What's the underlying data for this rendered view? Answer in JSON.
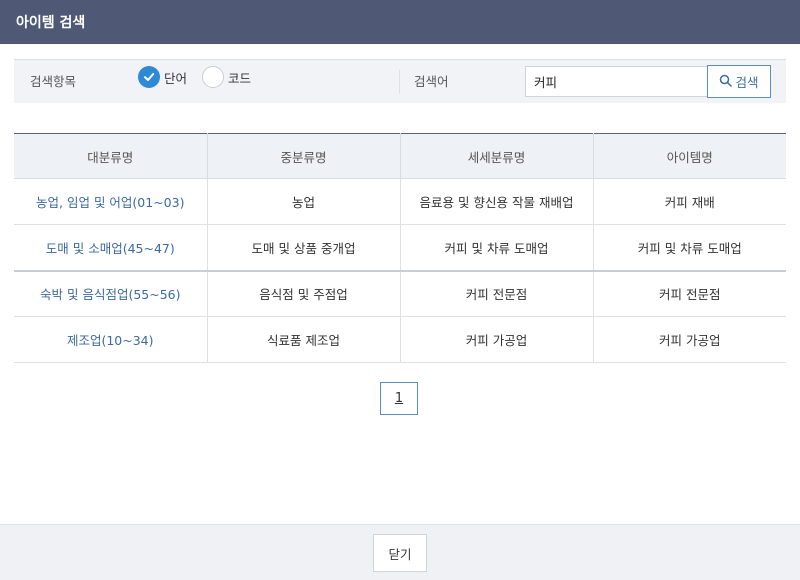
{
  "dialog": {
    "title": "아이템 검색"
  },
  "search": {
    "field_label": "검색항목",
    "radio_word": "단어",
    "radio_code": "코드",
    "selected": "단어",
    "word_label": "검색어",
    "input_value": "커피",
    "button_label": "검색",
    "button_icon": "search-icon"
  },
  "table": {
    "headers": [
      "대분류명",
      "중분류명",
      "세세분류명",
      "아이템명"
    ],
    "rows": [
      [
        "농업, 임업 및 어업(01~03)",
        "농업",
        "음료용 및 향신용 작물 재배업",
        "커피 재배"
      ],
      [
        "도매 및 소매업(45~47)",
        "도매 및 상품 중개업",
        "커피 및 차류 도매업",
        "커피 및 차류 도매업"
      ],
      [
        "숙박 및 음식점업(55~56)",
        "음식점 및 주점업",
        "커피 전문점",
        "커피 전문점"
      ],
      [
        "제조업(10~34)",
        "식료품 제조업",
        "커피 가공업",
        "커피 가공업"
      ]
    ]
  },
  "pagination": {
    "current": "1"
  },
  "footer": {
    "close_label": "닫기"
  },
  "colors": {
    "titlebar": "#4f5975",
    "accent": "#2f8ad6",
    "link": "#3b6aa0"
  }
}
